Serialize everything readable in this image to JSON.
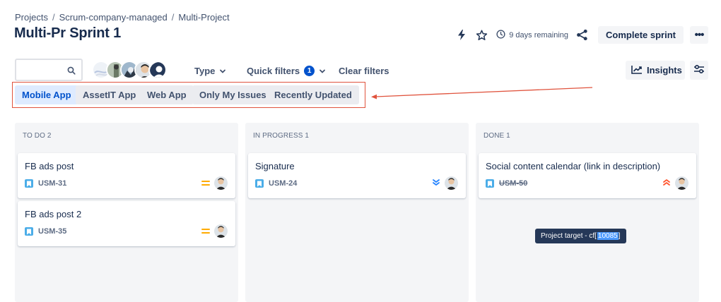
{
  "breadcrumb": {
    "items": [
      "Projects",
      "Scrum-company-managed",
      "Multi-Project"
    ],
    "separator": "/"
  },
  "title": "Multi-Pr Sprint 1",
  "header": {
    "remaining": "9 days remaining",
    "complete_label": "Complete sprint",
    "more_label": "•••"
  },
  "toolbar": {
    "type_label": "Type",
    "quick_filters_label": "Quick filters",
    "quick_filters_count": "1",
    "clear_label": "Clear filters",
    "insights_label": "Insights"
  },
  "quick_filters": [
    "Mobile App",
    "AssetIT App",
    "Web App",
    "Only My Issues",
    "Recently Updated"
  ],
  "colors": {
    "accent": "#0052cc",
    "annotation": "#e0533d",
    "story": "#4bade8",
    "medium": "#ffab00",
    "low": "#2684ff",
    "high": "#ff5630"
  },
  "columns": [
    {
      "title": "TO DO 2",
      "cards": [
        {
          "title": "FB ads post",
          "key": "USM-31",
          "priority": "medium"
        },
        {
          "title": "FB ads post 2",
          "key": "USM-35",
          "priority": "medium"
        }
      ]
    },
    {
      "title": "IN PROGRESS 1",
      "cards": [
        {
          "title": "Signature",
          "key": "USM-24",
          "priority": "lowest"
        }
      ]
    },
    {
      "title": "DONE 1",
      "cards": [
        {
          "title": "Social content calendar (link in description)",
          "key": "USM-50",
          "priority": "highest",
          "done": true
        }
      ]
    }
  ],
  "tooltip": {
    "text": "Project target - cf[",
    "highlight": "10085",
    "suffix": "]"
  }
}
